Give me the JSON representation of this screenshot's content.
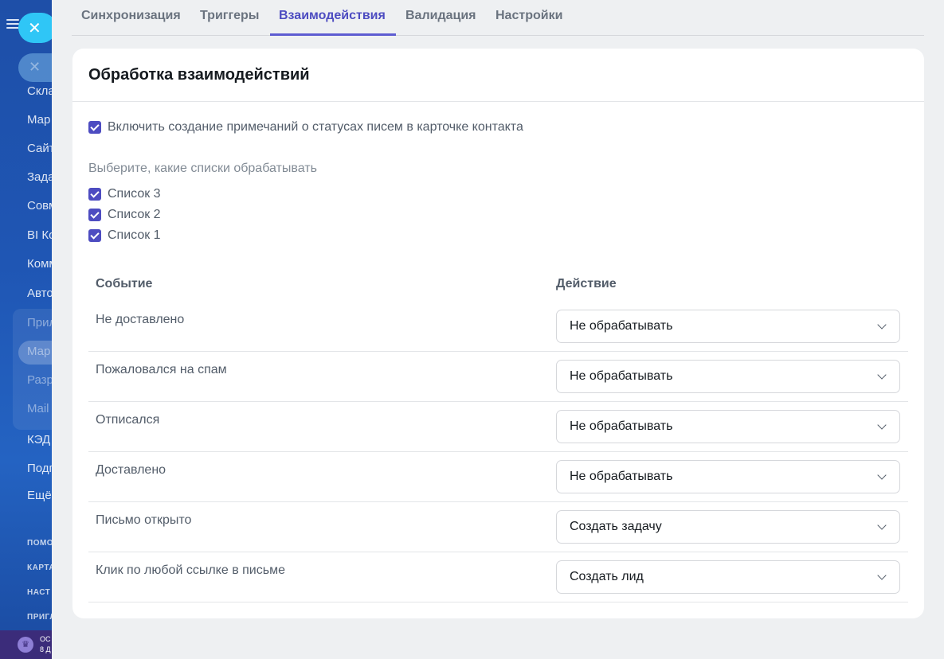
{
  "background_sidebar": {
    "items": [
      {
        "label": "Скла",
        "dim": false
      },
      {
        "label": "Мар",
        "dim": false
      },
      {
        "label": "Сайт",
        "dim": false
      },
      {
        "label": "Зада",
        "dim": false
      },
      {
        "label": "Совм",
        "dim": false
      },
      {
        "label": "BI Ко",
        "dim": false
      },
      {
        "label": "Комм",
        "dim": false
      },
      {
        "label": "Авто",
        "dim": false
      },
      {
        "label": "Прил",
        "dim": true
      },
      {
        "label": "Мар",
        "dim": true
      },
      {
        "label": "Разр",
        "dim": true
      },
      {
        "label": "Mail",
        "dim": true
      },
      {
        "label": "КЭД",
        "dim": false
      },
      {
        "label": "Подп",
        "dim": false
      },
      {
        "label": "Ещё",
        "dim": false
      }
    ],
    "small_items": [
      "ПОМО",
      "КАРТА",
      "НАСТ",
      "ПРИГЛ"
    ],
    "bottom_text_line1": "ОС",
    "bottom_text_line2": "8 Д"
  },
  "close_icon": "close-icon",
  "tabs": [
    {
      "label": "Синхронизация",
      "active": false
    },
    {
      "label": "Триггеры",
      "active": false
    },
    {
      "label": "Взаимодействия",
      "active": true
    },
    {
      "label": "Валидация",
      "active": false
    },
    {
      "label": "Настройки",
      "active": false
    }
  ],
  "card": {
    "title": "Обработка взаимодействий",
    "enable_notes_label": "Включить создание примечаний о статусах писем в карточке контакта",
    "enable_notes_checked": true,
    "lists_label": "Выберите, какие списки обрабатывать",
    "lists": [
      {
        "label": "Список 3",
        "checked": true
      },
      {
        "label": "Список 2",
        "checked": true
      },
      {
        "label": "Список 1",
        "checked": true
      }
    ],
    "table": {
      "col_event": "Событие",
      "col_action": "Действие",
      "rows": [
        {
          "event": "Не доставлено",
          "action": "Не обрабатывать"
        },
        {
          "event": "Пожаловался на спам",
          "action": "Не обрабатывать"
        },
        {
          "event": "Отписался",
          "action": "Не обрабатывать"
        },
        {
          "event": "Доставлено",
          "action": "Не обрабатывать"
        },
        {
          "event": "Письмо открыто",
          "action": "Создать задачу"
        },
        {
          "event": "Клик по любой ссылке в письме",
          "action": "Создать лид"
        }
      ]
    }
  },
  "colors": {
    "accent": "#4d4cc1",
    "close_button": "#2fc6f6",
    "sidebar": "#1f56b4"
  }
}
